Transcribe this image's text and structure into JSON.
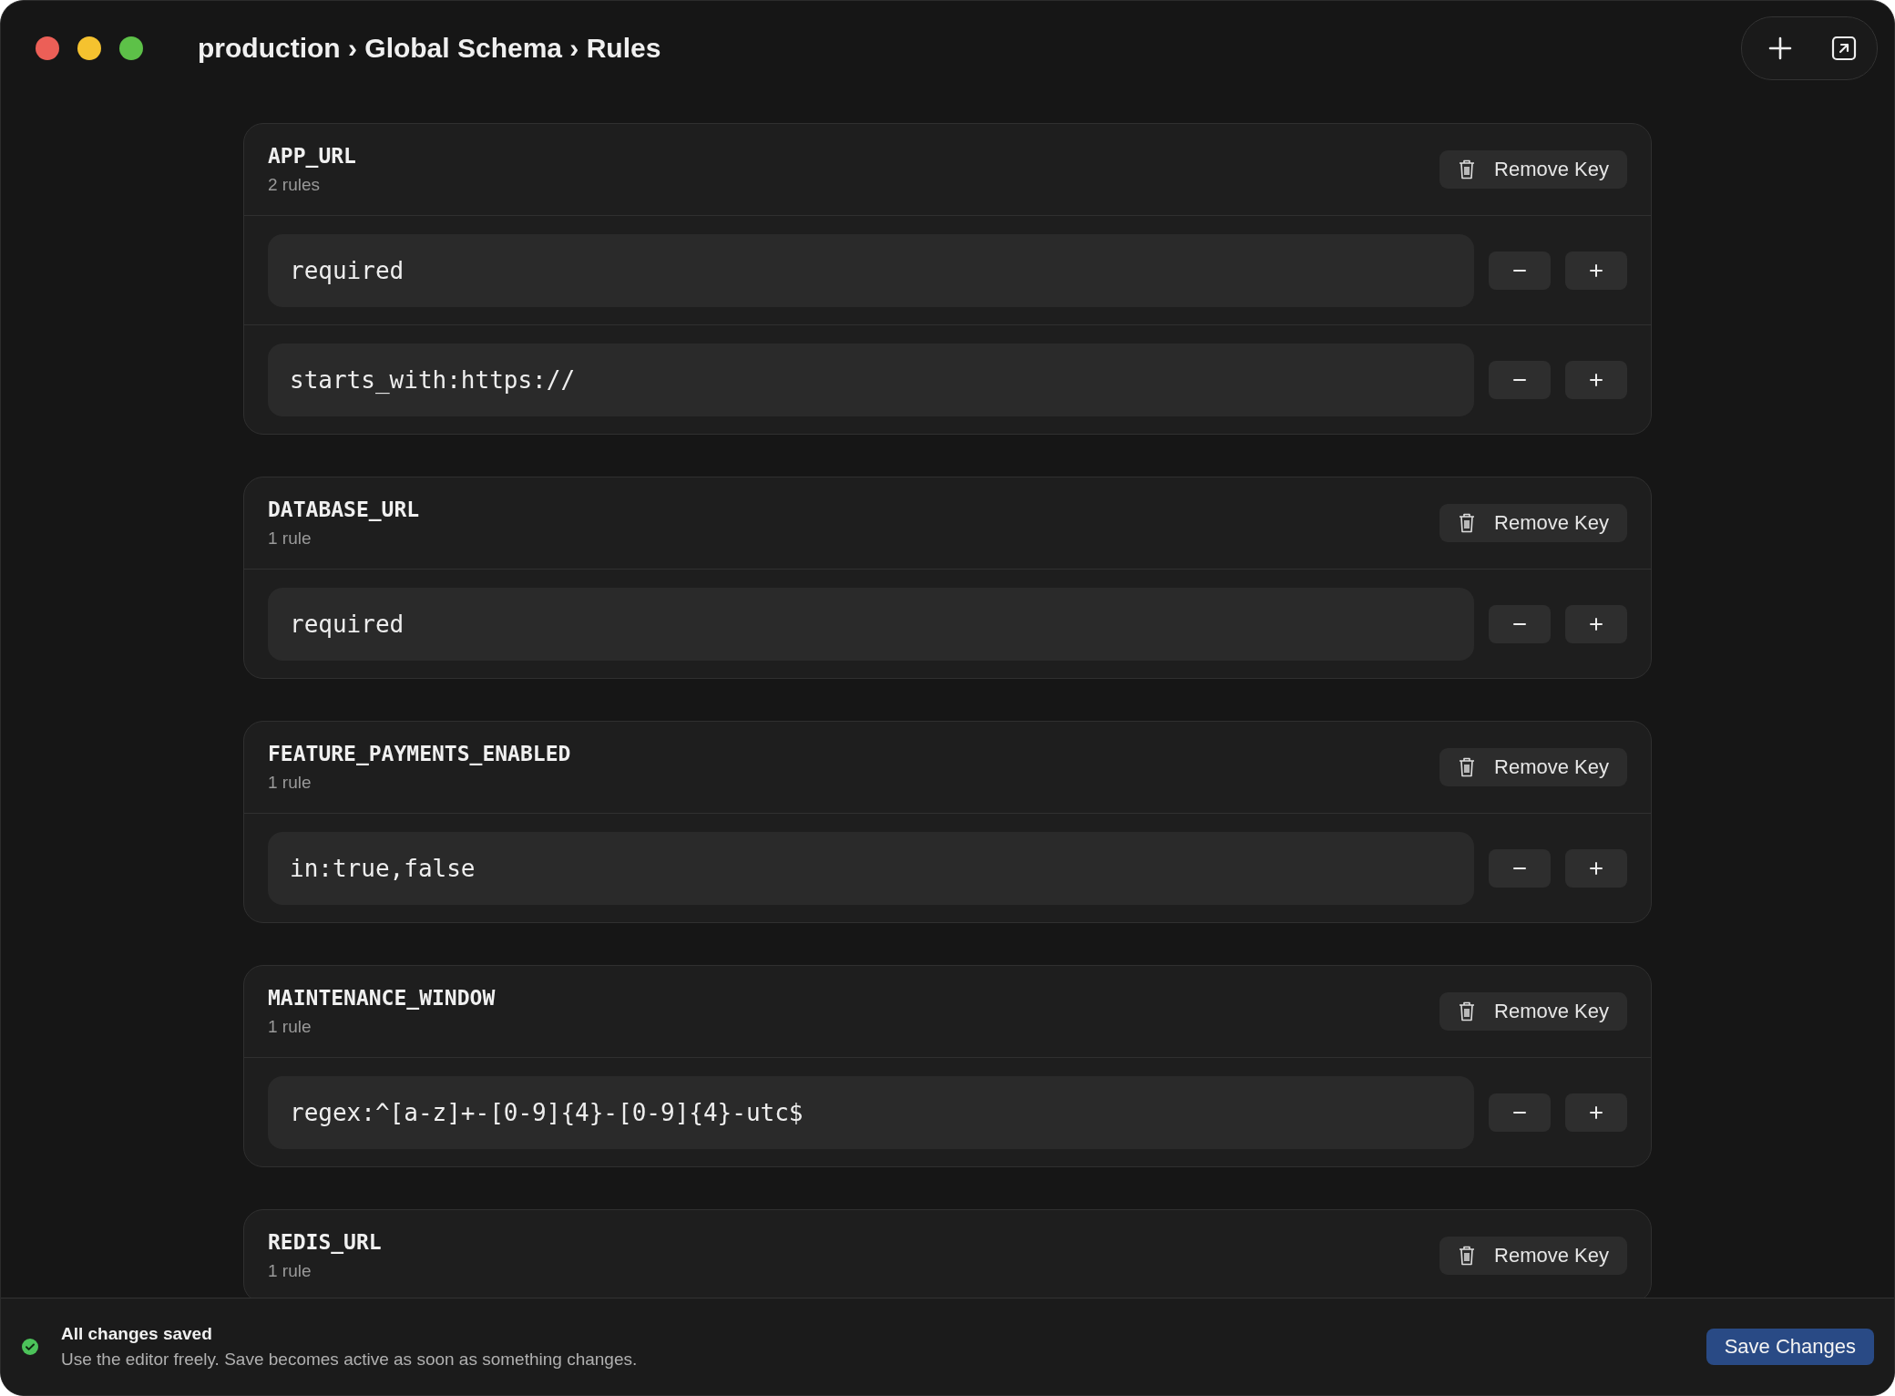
{
  "window": {
    "breadcrumb": "production › Global Schema › Rules"
  },
  "keys": [
    {
      "name": "APP_URL",
      "count": "2 rules",
      "remove_label": "Remove Key",
      "rules": [
        "required",
        "starts_with:https://"
      ]
    },
    {
      "name": "DATABASE_URL",
      "count": "1 rule",
      "remove_label": "Remove Key",
      "rules": [
        "required"
      ]
    },
    {
      "name": "FEATURE_PAYMENTS_ENABLED",
      "count": "1 rule",
      "remove_label": "Remove Key",
      "rules": [
        "in:true,false"
      ]
    },
    {
      "name": "MAINTENANCE_WINDOW",
      "count": "1 rule",
      "remove_label": "Remove Key",
      "rules": [
        "regex:^[a-z]+-[0-9]{4}-[0-9]{4}-utc$"
      ]
    },
    {
      "name": "REDIS_URL",
      "count": "1 rule",
      "remove_label": "Remove Key"
    }
  ],
  "status_bar": {
    "title": "All changes saved",
    "message": "Use the editor freely. Save becomes active as soon as something changes.",
    "save_button": "Save Changes"
  }
}
